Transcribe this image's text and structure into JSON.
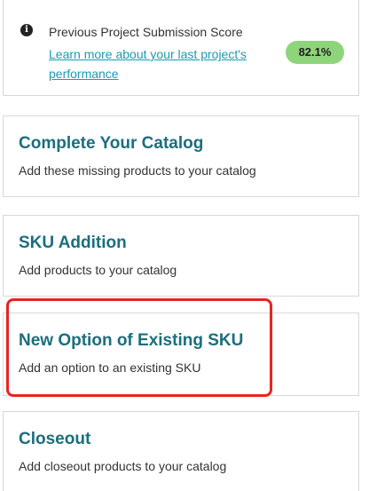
{
  "score": {
    "title": "Previous Project Submission Score",
    "link": "Learn more about your last project's performance",
    "badge": "82.1%"
  },
  "cards": [
    {
      "title": "Complete Your Catalog",
      "description": "Add these missing products to your catalog"
    },
    {
      "title": "SKU Addition",
      "description": "Add products to your catalog"
    },
    {
      "title": "New Option of Existing SKU",
      "description": "Add an option to an existing SKU"
    },
    {
      "title": "Closeout",
      "description": "Add closeout products to your catalog"
    }
  ],
  "colors": {
    "accent": "#1b6e7e",
    "link": "#1a9bb3",
    "badge": "#8ed47a",
    "highlight": "#e82424"
  }
}
